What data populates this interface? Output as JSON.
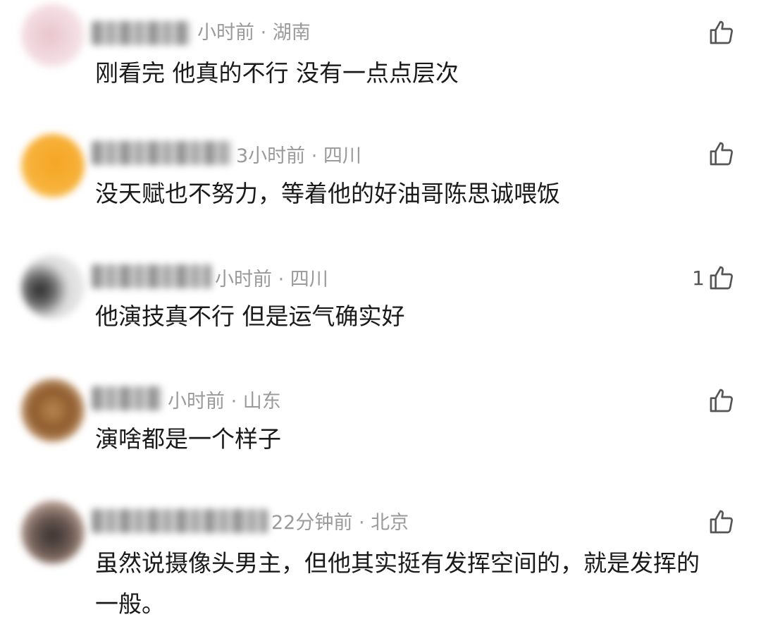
{
  "comments": [
    {
      "meta": "小时前 · 湖南",
      "text": "刚看完 他真的不行 没有一点点层次",
      "likes": ""
    },
    {
      "meta": "3小时前 · 四川",
      "text": "没天赋也不努力，等着他的好油哥陈思诚喂饭",
      "likes": ""
    },
    {
      "meta": "小时前 · 四川",
      "text": "他演技真不行 但是运气确实好",
      "likes": "1"
    },
    {
      "meta": "小时前 · 山东",
      "text": "演啥都是一个样子",
      "likes": ""
    },
    {
      "meta": "22分钟前 · 北京",
      "text": "虽然说摄像头男主，但他其实挺有发挥空间的，就是发挥的一般。",
      "likes": ""
    }
  ],
  "icons": {
    "like": "thumbs-up-icon",
    "avatar_style": "blurred"
  },
  "colors": {
    "meta": "#9a9a9a",
    "text": "#1a1a1a",
    "icon": "#555555"
  }
}
